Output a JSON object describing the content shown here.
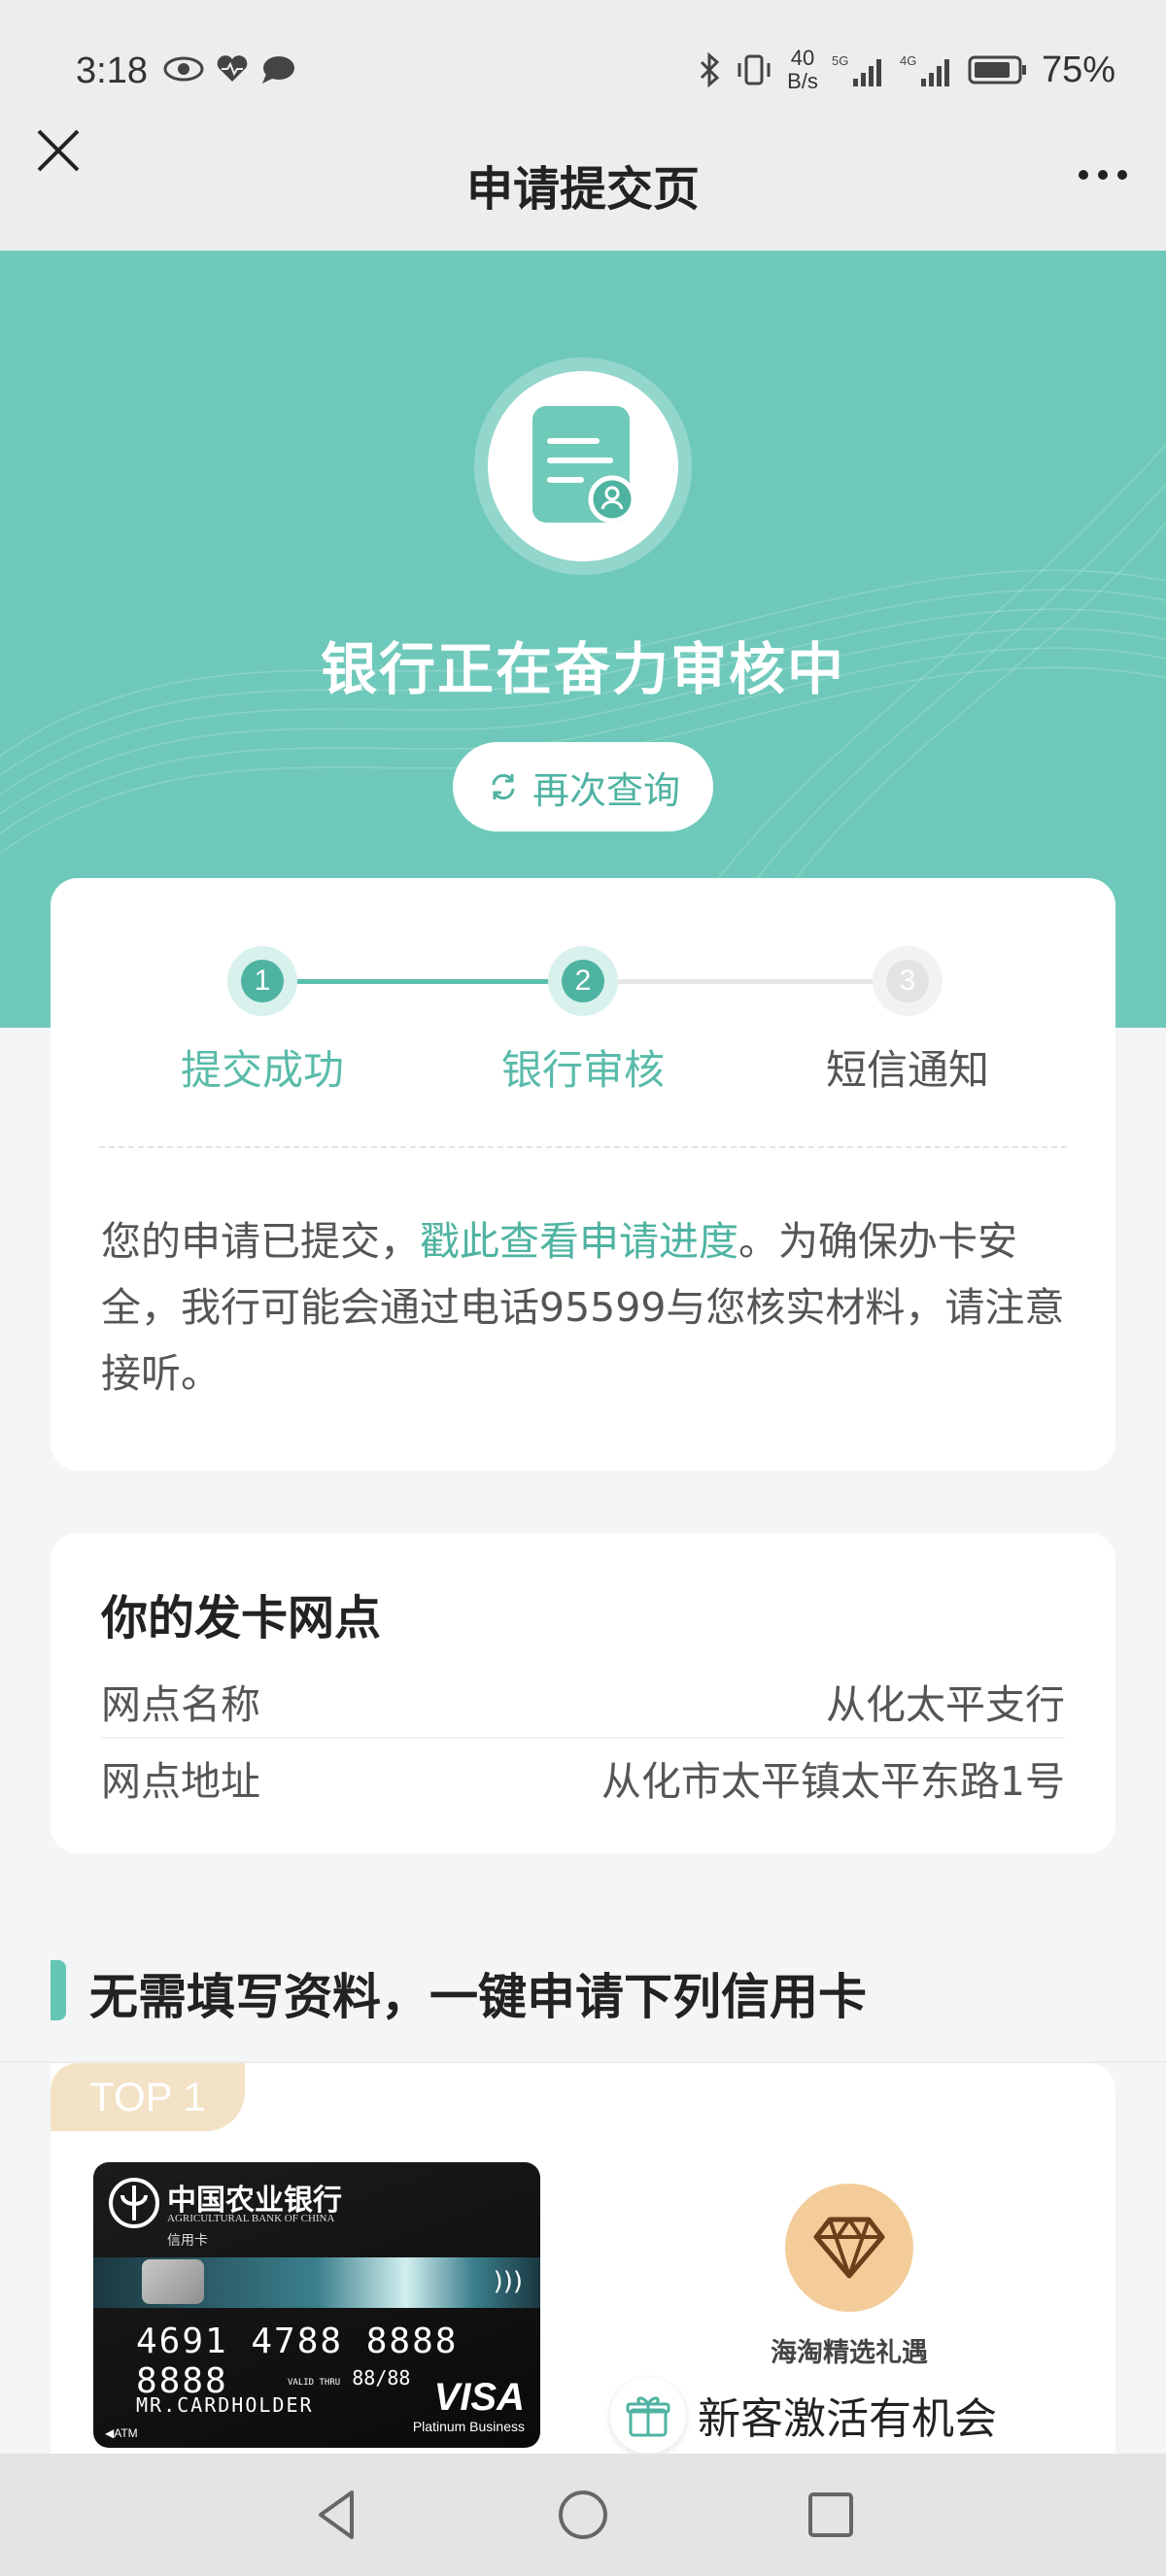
{
  "status_bar": {
    "time": "3:18",
    "net_speed_value": "40",
    "net_speed_unit": "B/s",
    "battery": "75%",
    "signal_label_1": "5G",
    "signal_label_2": "4G"
  },
  "nav": {
    "title": "申请提交页"
  },
  "hero": {
    "status_title": "银行正在奋力审核中",
    "requery_label": "再次查询",
    "bg_color": "#6fc9bb"
  },
  "progress": {
    "steps": [
      {
        "num": "1",
        "label": "提交成功",
        "state": "done"
      },
      {
        "num": "2",
        "label": "银行审核",
        "state": "done"
      },
      {
        "num": "3",
        "label": "短信通知",
        "state": "todo"
      }
    ],
    "notice_prefix": "您的申请已提交，",
    "notice_link": "戳此查看申请进度",
    "notice_suffix": "。为确保办卡安全，我行可能会通过电话95599与您核实材料，请注意接听。",
    "accent_color": "#4fb3a2"
  },
  "branch": {
    "title": "你的发卡网点",
    "rows": [
      {
        "label": "网点名称",
        "value": "从化太平支行"
      },
      {
        "label": "网点地址",
        "value": "从化市太平镇太平东路1号"
      }
    ]
  },
  "recommend": {
    "section_title": "无需填写资料，一键申请下列信用卡",
    "badge": "TOP 1",
    "card": {
      "bank_name": "中国农业银行",
      "bank_name_en": "AGRICULTURAL BANK OF CHINA",
      "card_type": "信用卡",
      "number": "4691 4788 8888 8888",
      "valid_label": "VALID THRU",
      "valid": "88/88",
      "holder": "MR.CARDHOLDER",
      "brand": "VISA",
      "brand_sub": "Platinum Business",
      "atm": "◀ATM"
    },
    "gift_label": "海淘精选礼遇",
    "activate_text": "新客激活有机会"
  },
  "icons": {
    "close": "close-icon",
    "more": "more-icon",
    "document": "document-user-icon",
    "refresh": "refresh-icon",
    "diamond": "diamond-icon",
    "gift": "gift-icon"
  }
}
